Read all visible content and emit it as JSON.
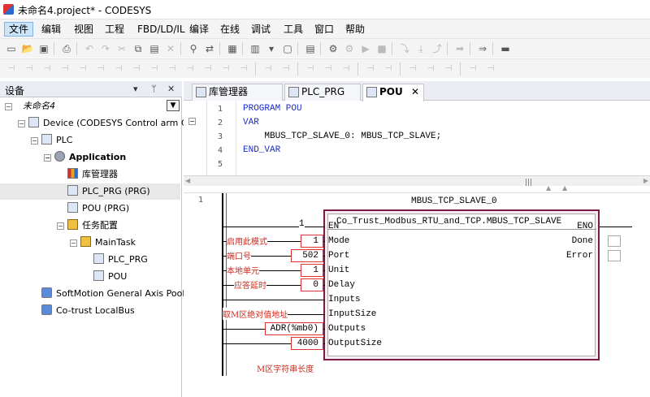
{
  "window": {
    "title": "未命名4.project* - CODESYS"
  },
  "menu": [
    "文件",
    "编辑",
    "视图",
    "工程",
    "FBD/LD/IL",
    "编译",
    "在线",
    "调试",
    "工具",
    "窗口",
    "帮助"
  ],
  "devices_panel": {
    "title": "设备",
    "tree": [
      {
        "label": "未命名4",
        "indent": 0,
        "expander": "-",
        "italic": true
      },
      {
        "label": "Device (CODESYS Control arm CT",
        "indent": 1,
        "expander": "-"
      },
      {
        "label": "PLC",
        "indent": 2,
        "expander": "-"
      },
      {
        "label": "Application",
        "indent": 3,
        "expander": "-",
        "bold": true
      },
      {
        "label": "库管理器",
        "indent": 4
      },
      {
        "label": "PLC_PRG (PRG)",
        "indent": 4,
        "selected": true
      },
      {
        "label": "POU (PRG)",
        "indent": 4
      },
      {
        "label": "任务配置",
        "indent": 4,
        "expander": "-"
      },
      {
        "label": "MainTask",
        "indent": 5,
        "expander": "-"
      },
      {
        "label": "PLC_PRG",
        "indent": 6
      },
      {
        "label": "POU",
        "indent": 6
      },
      {
        "label": "SoftMotion General Axis Pool",
        "indent": 2
      },
      {
        "label": "Co-trust LocalBus",
        "indent": 2
      }
    ]
  },
  "tabs": [
    {
      "label": "库管理器",
      "active": false
    },
    {
      "label": "PLC_PRG",
      "active": false
    },
    {
      "label": "POU",
      "active": true
    }
  ],
  "declaration": {
    "lines": [
      {
        "n": "1",
        "text": "PROGRAM POU",
        "kw": true
      },
      {
        "n": "2",
        "text": "VAR",
        "kw": true
      },
      {
        "n": "3",
        "text": "    MBUS_TCP_SLAVE_0: MBUS_TCP_SLAVE;",
        "kw": false
      },
      {
        "n": "4",
        "text": "END_VAR",
        "kw": true
      },
      {
        "n": "5",
        "text": "",
        "kw": false
      }
    ]
  },
  "fbd": {
    "network_number": "1",
    "instance_name": "MBUS_TCP_SLAVE_0",
    "type_name": "Co_Trust_Modbus_RTU_and_TCP.MBUS_TCP_SLAVE",
    "inputs": [
      {
        "name": "EN",
        "value": "1",
        "boxed": false,
        "note": ""
      },
      {
        "name": "Mode",
        "value": "1",
        "boxed": true,
        "note": "启用此模式"
      },
      {
        "name": "Port",
        "value": "502",
        "boxed": true,
        "note": "端口号"
      },
      {
        "name": "Unit",
        "value": "1",
        "boxed": true,
        "note": "本地单元"
      },
      {
        "name": "Delay",
        "value": "0",
        "boxed": true,
        "note": "应答延时"
      },
      {
        "name": "Inputs",
        "value": "",
        "boxed": false,
        "note": ""
      },
      {
        "name": "InputSize",
        "value": "",
        "boxed": false,
        "note": "取M区绝对值地址"
      },
      {
        "name": "Outputs",
        "value": "ADR(%mb0)",
        "boxed": true,
        "note": ""
      },
      {
        "name": "OutputSize",
        "value": "4000",
        "boxed": true,
        "note": ""
      }
    ],
    "outputs": [
      {
        "name": "ENO"
      },
      {
        "name": "Done"
      },
      {
        "name": "Error"
      }
    ],
    "footnote": "M区字符串长度"
  }
}
